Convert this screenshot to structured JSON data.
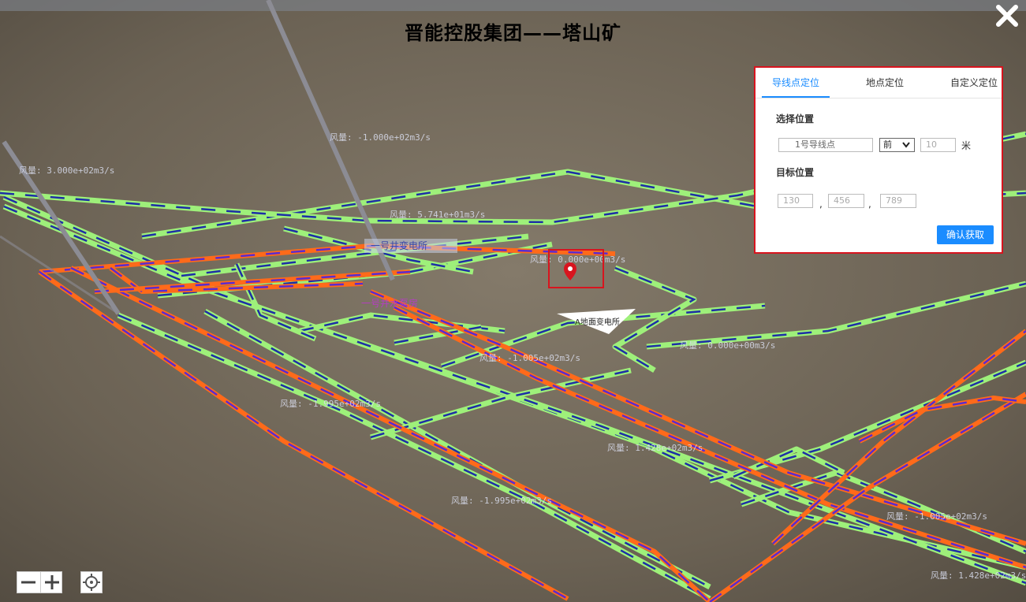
{
  "title": "晋能控股集团——塔山矿",
  "location_panel": {
    "tabs": [
      {
        "label": "导线点定位",
        "active": true
      },
      {
        "label": "地点定位",
        "active": false
      },
      {
        "label": "自定义定位",
        "active": false
      }
    ],
    "select_position_label": "选择位置",
    "guide_point_value": "1号导线点",
    "direction_value": "前",
    "distance_placeholder": "10",
    "unit": "米",
    "target_position_label": "目标位置",
    "target_x_placeholder": "130",
    "target_y_placeholder": "456",
    "target_z_placeholder": "789",
    "coord_separator": ",",
    "confirm_label": "确认获取"
  },
  "map_labels": {
    "airflow": [
      "风量: -1.000e+02m3/s",
      "风量: 3.000e+02m3/s",
      "风量: 5.741e+01m3/s",
      "风量: 0.000e+00m3/s",
      "风量: -1.005e+02m3/s",
      "风量: 0.000e+00m3/s",
      "风量: -1.995e+02m3/s",
      "风量: 1.428e+02m3/s",
      "风量: -1.995e+02m3/s",
      "风量: -1.005e+02m3/s",
      "风量: 1.428e+02m3/s"
    ],
    "substation_1": "一号井变电所",
    "pump_house": "一号井水泵房",
    "ground_substation": "A地面变电所"
  },
  "colors": {
    "accent": "#1a8cff",
    "highlight_border": "#d8141e",
    "tunnel_green": "#9ef07a",
    "tunnel_blue": "#1d2fa6",
    "tunnel_orange": "#ff6a1a",
    "tunnel_purple": "#5a2bd0",
    "ground": "#6f6658",
    "marker": "#d8141e"
  },
  "icons": {
    "close": "close-icon",
    "zoom_out": "minus-icon",
    "zoom_in": "plus-icon",
    "locate": "crosshair-icon",
    "marker": "map-pin-icon"
  }
}
